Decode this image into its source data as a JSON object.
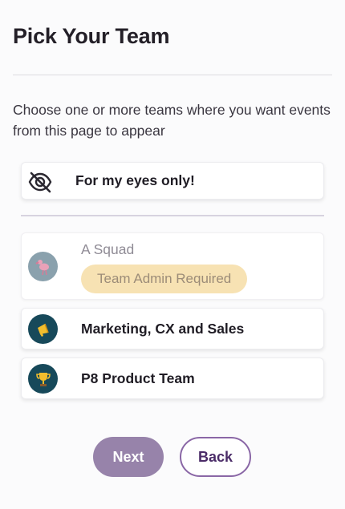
{
  "header": {
    "title": "Pick Your Team"
  },
  "intro": {
    "text": "Choose one or more teams where you want events from this page to appear"
  },
  "private_option": {
    "label": "For my eyes only!",
    "icon": "eye-slash-icon"
  },
  "teams": [
    {
      "name": "A Squad",
      "badge": "Team Admin Required",
      "icon": "flamingo-icon",
      "disabled": true,
      "avatar_color": "#8aa1ad"
    },
    {
      "name": "Marketing, CX and Sales",
      "icon": "megaphone-icon",
      "avatar_color": "#17495a"
    },
    {
      "name": "P8 Product Team",
      "icon": "trophy-icon",
      "avatar_color": "#17495a"
    }
  ],
  "actions": {
    "next_label": "Next",
    "back_label": "Back"
  },
  "colors": {
    "primary": "#9783aa",
    "back_border": "#8a67a6",
    "badge_bg": "#f7e2b3",
    "avatar_dark": "#17495a"
  }
}
